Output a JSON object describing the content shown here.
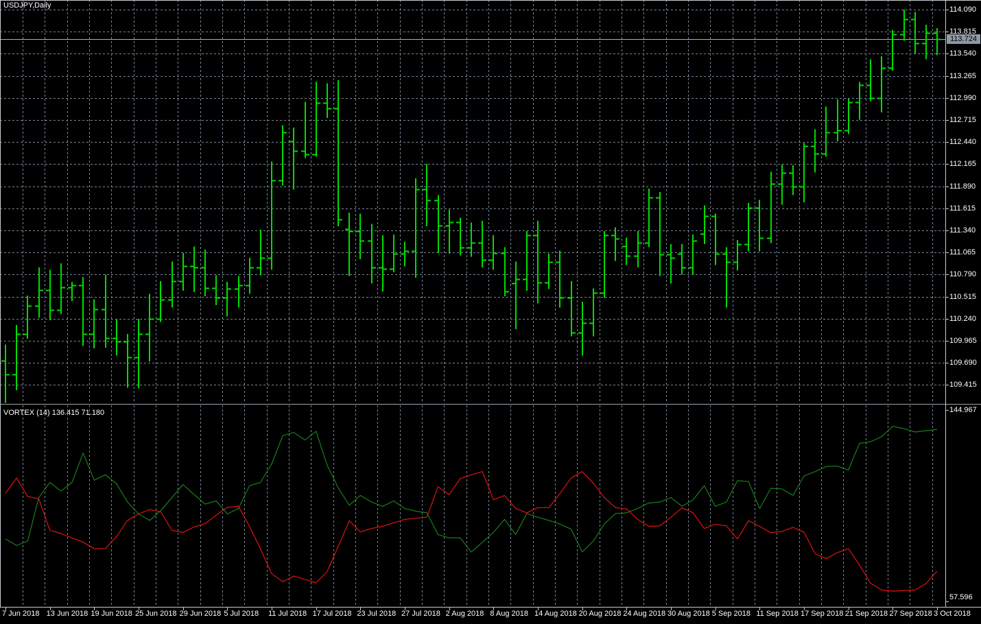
{
  "window": {
    "symbol_label": "USDJPY,Daily",
    "background": "#000000",
    "grid_color": "#778899",
    "border_color": "#C8CDD2",
    "text_color": "#FFFFFF"
  },
  "main_chart": {
    "bar_color": "#00DC00",
    "price_line_color": "#A9B3BC",
    "price_axis": {
      "tick_labels": [
        "114.090",
        "113.815",
        "113.540",
        "113.265",
        "112.990",
        "112.715",
        "112.440",
        "112.165",
        "111.890",
        "111.615",
        "111.340",
        "111.065",
        "110.790",
        "110.515",
        "110.240",
        "109.965",
        "109.690",
        "109.415"
      ],
      "current_label": "113.724",
      "current_price": 113.724,
      "label_bg": "#8E99A6"
    }
  },
  "indicator": {
    "full_label": "VORTEX (14) 136.415 71.180",
    "name": "VORTEX",
    "period": "14",
    "vi_plus_value": "136.415",
    "vi_minus_value": "71.180",
    "axis_max": "144.967",
    "axis_min": "57.596",
    "plus_color": "#1B7E1B",
    "minus_color": "#E21212"
  },
  "time_axis": {
    "labels": [
      "7 Jun 2018",
      "13 Jun 2018",
      "19 Jun 2018",
      "25 Jun 2018",
      "29 Jun 2018",
      "5 Jul 2018",
      "11 Jul 2018",
      "17 Jul 2018",
      "23 Jul 2018",
      "27 Jul 2018",
      "2 Aug 2018",
      "8 Aug 2018",
      "14 Aug 2018",
      "20 Aug 2018",
      "24 Aug 2018",
      "30 Aug 2018",
      "5 Sep 2018",
      "11 Sep 2018",
      "17 Sep 2018",
      "21 Sep 2018",
      "27 Sep 2018",
      "3 Oct 2018"
    ],
    "bars_per_label": 4
  },
  "chart_data": [
    {
      "type": "bar",
      "title": "USDJPY,Daily",
      "symbol": "USDJPY",
      "timeframe": "Daily",
      "ylim": [
        109.19,
        114.21
      ],
      "y_ticks": [
        114.09,
        113.815,
        113.54,
        113.265,
        112.99,
        112.715,
        112.44,
        112.165,
        111.89,
        111.615,
        111.34,
        111.065,
        110.79,
        110.515,
        110.24,
        109.965,
        109.69,
        109.415
      ],
      "current_price": 113.724,
      "grid": "dashed",
      "ohlc": [
        [
          109.72,
          109.92,
          109.19,
          109.55
        ],
        [
          109.55,
          110.16,
          109.35,
          110.05
        ],
        [
          110.05,
          110.53,
          109.99,
          110.4
        ],
        [
          110.4,
          110.88,
          110.25,
          110.6
        ],
        [
          110.6,
          110.85,
          110.22,
          110.35
        ],
        [
          110.35,
          110.93,
          110.3,
          110.63
        ],
        [
          110.63,
          110.7,
          110.46,
          110.66
        ],
        [
          110.66,
          110.76,
          109.9,
          110.05
        ],
        [
          110.05,
          110.48,
          109.87,
          110.36
        ],
        [
          110.36,
          110.79,
          109.88,
          110.0
        ],
        [
          110.0,
          110.24,
          109.78,
          109.96
        ],
        [
          109.96,
          110.05,
          109.38,
          109.76
        ],
        [
          109.76,
          110.24,
          109.37,
          110.05
        ],
        [
          110.05,
          110.55,
          109.71,
          110.24
        ],
        [
          110.24,
          110.71,
          110.2,
          110.48
        ],
        [
          110.48,
          110.95,
          110.38,
          110.71
        ],
        [
          110.71,
          111.06,
          110.59,
          110.9
        ],
        [
          110.9,
          111.14,
          110.57,
          110.88
        ],
        [
          110.88,
          111.1,
          110.52,
          110.62
        ],
        [
          110.62,
          110.78,
          110.41,
          110.5
        ],
        [
          110.5,
          110.7,
          110.27,
          110.61
        ],
        [
          110.61,
          110.77,
          110.38,
          110.66
        ],
        [
          110.66,
          111.0,
          110.55,
          110.88
        ],
        [
          110.88,
          111.35,
          110.78,
          111.0
        ],
        [
          111.0,
          112.2,
          110.85,
          111.96
        ],
        [
          111.96,
          112.65,
          111.9,
          112.56
        ],
        [
          112.45,
          112.62,
          111.85,
          112.33
        ],
        [
          112.33,
          112.94,
          112.24,
          112.29
        ],
        [
          112.29,
          113.19,
          112.26,
          112.93
        ],
        [
          112.93,
          113.17,
          112.74,
          112.86
        ],
        [
          112.86,
          113.21,
          111.39,
          111.48
        ],
        [
          111.36,
          111.56,
          110.77,
          111.33
        ],
        [
          111.33,
          111.55,
          110.98,
          111.21
        ],
        [
          111.21,
          111.42,
          110.68,
          110.88
        ],
        [
          110.88,
          111.28,
          110.58,
          110.86
        ],
        [
          110.86,
          111.29,
          110.82,
          111.05
        ],
        [
          111.05,
          111.2,
          110.89,
          111.08
        ],
        [
          111.08,
          111.99,
          110.75,
          111.85
        ],
        [
          111.85,
          112.17,
          111.39,
          111.72
        ],
        [
          111.72,
          111.78,
          111.06,
          111.4
        ],
        [
          111.4,
          111.6,
          111.05,
          111.44
        ],
        [
          111.44,
          111.5,
          111.03,
          111.13
        ],
        [
          111.13,
          111.44,
          111.01,
          111.19
        ],
        [
          111.19,
          111.46,
          110.88,
          110.97
        ],
        [
          110.97,
          111.28,
          110.85,
          111.06
        ],
        [
          111.06,
          111.13,
          110.52,
          110.58
        ],
        [
          110.68,
          110.95,
          110.11,
          110.73
        ],
        [
          110.73,
          111.33,
          110.59,
          111.28
        ],
        [
          111.28,
          111.46,
          110.43,
          110.69
        ],
        [
          110.69,
          111.05,
          110.61,
          110.95
        ],
        [
          110.95,
          111.09,
          110.38,
          110.5
        ],
        [
          110.5,
          110.71,
          110.02,
          110.07
        ],
        [
          110.07,
          110.45,
          109.78,
          110.19
        ],
        [
          110.19,
          110.62,
          110.02,
          110.56
        ],
        [
          110.56,
          111.33,
          110.5,
          111.28
        ],
        [
          111.28,
          111.38,
          110.96,
          111.24
        ],
        [
          111.14,
          111.25,
          110.91,
          111.02
        ],
        [
          111.02,
          111.33,
          110.88,
          111.19
        ],
        [
          111.19,
          111.86,
          111.13,
          111.75
        ],
        [
          111.75,
          111.82,
          110.77,
          111.04
        ],
        [
          111.04,
          111.17,
          110.68,
          111.0
        ],
        [
          111.05,
          111.17,
          110.79,
          110.88
        ],
        [
          110.88,
          111.29,
          110.79,
          111.21
        ],
        [
          111.3,
          111.65,
          111.17,
          111.52
        ],
        [
          111.52,
          111.55,
          110.91,
          111.05
        ],
        [
          111.05,
          111.13,
          110.38,
          110.95
        ],
        [
          110.95,
          111.22,
          110.84,
          111.17
        ],
        [
          111.17,
          111.68,
          111.08,
          111.62
        ],
        [
          111.62,
          111.72,
          111.08,
          111.25
        ],
        [
          111.25,
          112.07,
          111.18,
          111.92
        ],
        [
          111.92,
          112.16,
          111.66,
          112.06
        ],
        [
          112.06,
          112.15,
          111.78,
          111.89
        ],
        [
          111.89,
          112.43,
          111.69,
          112.39
        ],
        [
          112.39,
          112.6,
          112.06,
          112.3
        ],
        [
          112.3,
          112.88,
          112.26,
          112.56
        ],
        [
          112.56,
          112.97,
          112.45,
          112.59
        ],
        [
          112.59,
          112.98,
          112.54,
          112.94
        ],
        [
          112.94,
          113.19,
          112.72,
          113.15
        ],
        [
          113.15,
          113.47,
          112.95,
          112.99
        ],
        [
          112.99,
          113.51,
          112.81,
          113.36
        ],
        [
          113.36,
          113.84,
          113.33,
          113.78
        ],
        [
          113.78,
          114.09,
          113.7,
          113.97
        ],
        [
          113.97,
          114.06,
          113.54,
          113.67
        ],
        [
          113.67,
          113.9,
          113.47,
          113.8
        ],
        [
          113.8,
          113.86,
          113.52,
          113.72
        ]
      ]
    },
    {
      "type": "line",
      "title": "VORTEX (14)",
      "ylim": [
        57.596,
        144.967
      ],
      "legend_position": "top-left",
      "series": [
        {
          "name": "VI+",
          "color": "#1B7E1B",
          "values": [
            86,
            83,
            85,
            105,
            112,
            108,
            112,
            125.5,
            113,
            115.5,
            111.5,
            103,
            97.5,
            94.5,
            99,
            105,
            111,
            106.5,
            102,
            103.5,
            97.5,
            100,
            110.5,
            112,
            120.5,
            133.5,
            135,
            131.5,
            135.5,
            120,
            109.5,
            101.5,
            106,
            103,
            101,
            103.5,
            100,
            98.8,
            98,
            88,
            86.5,
            86.5,
            80,
            84.5,
            89,
            95,
            88,
            97.7,
            96,
            94.5,
            92.8,
            90.5,
            80,
            85,
            93,
            97.7,
            98,
            100,
            102.5,
            103,
            105,
            101,
            104,
            110.5,
            101,
            103,
            112.8,
            112.4,
            100,
            109.3,
            109,
            106,
            115,
            117,
            119.3,
            119.5,
            117.7,
            130,
            130.7,
            133,
            137.8,
            136.8,
            135.2,
            135.8,
            136.415
          ]
        },
        {
          "name": "VI-",
          "color": "#E21212",
          "values": [
            107,
            114,
            105.5,
            104.5,
            90,
            88.5,
            86.5,
            84.5,
            81.5,
            81.5,
            87,
            94.5,
            97.5,
            99.5,
            98.5,
            90,
            89,
            91.5,
            93,
            97,
            100.5,
            101,
            91.8,
            81.4,
            70,
            66.3,
            68.9,
            67.4,
            65.8,
            71,
            82.5,
            94.4,
            89.2,
            90.8,
            91.8,
            93.4,
            95,
            95.5,
            96,
            110,
            106.4,
            113.7,
            115.5,
            117,
            104,
            106,
            100,
            98,
            100.4,
            100.4,
            107,
            114,
            117,
            111.6,
            105,
            100.4,
            99.8,
            95,
            91.8,
            92,
            96,
            100.3,
            98,
            90.8,
            92.7,
            92,
            86,
            94.4,
            91.8,
            88.9,
            89.5,
            91.3,
            89.1,
            79.2,
            76.9,
            79.7,
            81.5,
            74,
            65.7,
            62.5,
            62,
            62.2,
            62.5,
            65.5,
            71.18
          ]
        }
      ]
    }
  ]
}
